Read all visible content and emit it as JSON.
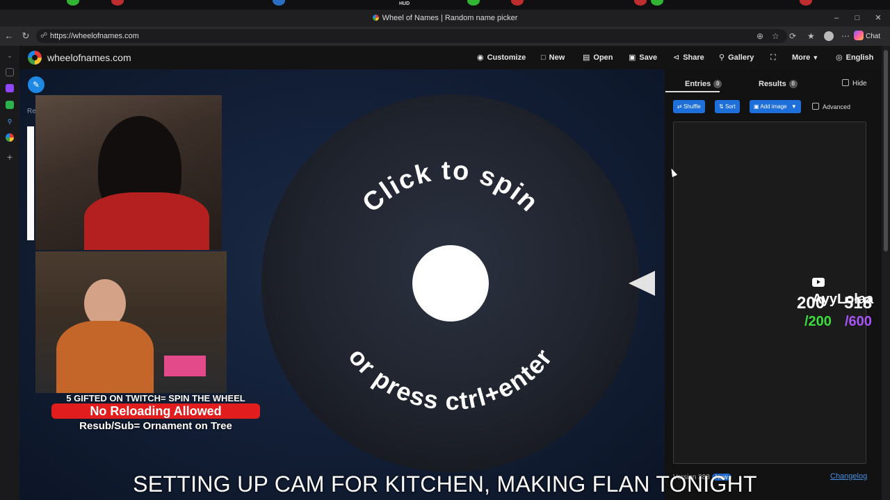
{
  "browser": {
    "window_title": "Wheel of Names | Random name picker",
    "url": "https://wheelofnames.com",
    "chat_label": "Chat",
    "tab_strip_label": "HUD"
  },
  "app": {
    "brand": "wheelofnames.com",
    "menu": {
      "customize": "Customize",
      "new": "New",
      "open": "Open",
      "save": "Save",
      "share": "Share",
      "gallery": "Gallery",
      "more": "More",
      "language": "English"
    }
  },
  "wheel": {
    "top_text": "Click to spin",
    "bottom_text": "or press ctrl+enter"
  },
  "left_panel": {
    "label": "Re"
  },
  "panel": {
    "tabs": {
      "entries_label": "Entries",
      "entries_count": "0",
      "results_label": "Results",
      "results_count": "0"
    },
    "hide_label": "Hide",
    "buttons": {
      "shuffle": "Shuffle",
      "sort": "Sort",
      "add_image": "Add image"
    },
    "advanced_label": "Advanced",
    "version": "Version 388",
    "new_badge": "New",
    "changelog": "Changelog"
  },
  "stream_overlay": {
    "line1": "5 GIFTED ON TWITCH= SPIN THE WHEEL",
    "line2": "No Reloading Allowed",
    "line3": "Resub/Sub= Ornament on Tree",
    "youtube_name": "AyyLolaa",
    "goal1_current": "200",
    "goal1_target": "/200",
    "goal2_current": "518",
    "goal2_target": "/600",
    "caption": "SETTING UP CAM FOR KITCHEN, MAKING FLAN TONIGHT"
  },
  "colors": {
    "accent": "#1e6fd9",
    "goal_green": "#3ddc3d",
    "goal_purple": "#a855f7",
    "banner_red": "#e11d1d"
  }
}
